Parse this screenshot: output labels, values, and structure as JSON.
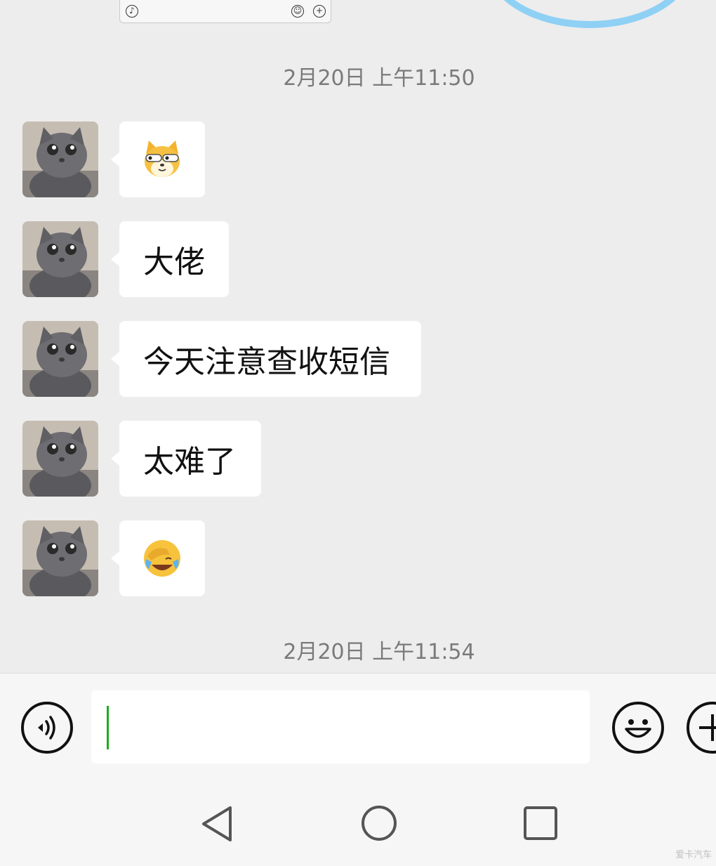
{
  "timestamps": [
    "2月20日 上午11:50",
    "2月20日 上午11:54"
  ],
  "messages": [
    {
      "type": "emoji",
      "emoji": "doge-emoji"
    },
    {
      "type": "text",
      "text": "大佬"
    },
    {
      "type": "text",
      "text": "今天注意查收短信"
    },
    {
      "type": "text",
      "text": "太难了"
    },
    {
      "type": "emoji",
      "emoji": "facepalm-laugh-emoji"
    }
  ],
  "input": {
    "value": ""
  },
  "icons": {
    "voice": "voice-icon",
    "emoji": "smiley-icon",
    "more": "plus-icon",
    "back": "back-triangle-icon",
    "home": "home-circle-icon",
    "recents": "recents-square-icon"
  },
  "colors": {
    "bubble": "#ffffff",
    "background": "#ededed",
    "caret": "#1aad19"
  },
  "watermark": "爱卡汽车"
}
